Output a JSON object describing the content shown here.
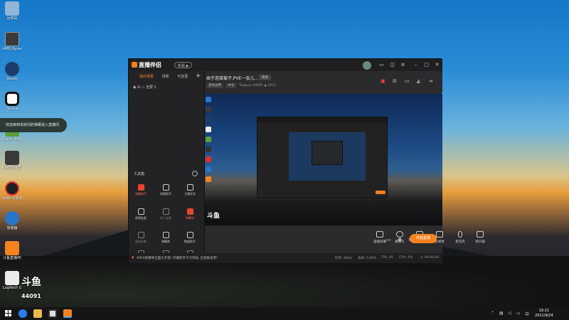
{
  "desktop": {
    "icons": [
      {
        "label": "回收站",
        "color": "#8fb6d9"
      },
      {
        "label": "AMD Ryzen Master",
        "color": "#3a3a3a"
      },
      {
        "label": "Steam",
        "color": "#1b3d6b"
      },
      {
        "label": "Oculus",
        "color": "#f2f2f2"
      },
      {
        "label": "Daum PotPlayer",
        "color": "#5a9e3a"
      },
      {
        "label": "GeForce Experience",
        "color": "#3a3a3a"
      },
      {
        "label": "网易UU加速器",
        "color": "#1f1f1f"
      },
      {
        "label": "加速器",
        "color": "#2a74c9"
      },
      {
        "label": "斗鱼直播伴侣",
        "color": "#f5821f"
      },
      {
        "label": "Logitech G HUB",
        "color": "#ececec"
      }
    ],
    "notification": "欢迎来到本房间的弹幕进入直播间",
    "douyu_watermark": "斗鱼",
    "room_number": "44091"
  },
  "app": {
    "title": "直播伴侣",
    "version_badge": "新版 ▶",
    "left_tabs": [
      "我的场景",
      "场景",
      "可放置"
    ],
    "scene_name": "全屏 1",
    "tools_title": "工具箱",
    "tools": [
      {
        "label": "弹幕助手",
        "hot": true
      },
      {
        "label": "房管助手",
        "hot": false
      },
      {
        "label": "主播任务",
        "hot": false
      },
      {
        "label": "视频连麦",
        "hot": false
      },
      {
        "label": "多人连麦",
        "hot": false
      },
      {
        "label": "弹幕机",
        "hot": true
      },
      {
        "label": "虚拟形象",
        "hot": false
      },
      {
        "label": "弹幕库",
        "hot": false
      },
      {
        "label": "数据助手",
        "hot": false
      },
      {
        "label": "礼物特效",
        "hot": false
      },
      {
        "label": "直播回放",
        "hot": false
      },
      {
        "label": "音频设置",
        "hot": false
      }
    ],
    "room_title": "由于连接被子,PVE一会儿...",
    "edit_label": "修改",
    "room_meta": {
      "category": "星际战甲",
      "mode": "中文",
      "viewers_label": "Topguys",
      "viewers": "44091",
      "heat": "1013"
    },
    "toolbar": [
      {
        "label": "直播屏幕"
      },
      {
        "label": "摄像头"
      },
      {
        "label": "手机投屏"
      },
      {
        "label": "多媒体"
      },
      {
        "label": "麦克风"
      },
      {
        "label": "扬声器"
      }
    ],
    "go_live": "开始直播",
    "status": {
      "news": "APEX新赛季全面大开放! 开播即享千元奖励, 赶紧报名吧!",
      "bitrate": "码率: 0kb/s",
      "dropped": "丢帧: 0.00%",
      "fps": "FPS: 60",
      "cpu": "CPU: 4%",
      "time": "00:00:00"
    }
  },
  "taskbar": {
    "time": "19:21",
    "date": "2021/9/24",
    "lang": "中"
  }
}
